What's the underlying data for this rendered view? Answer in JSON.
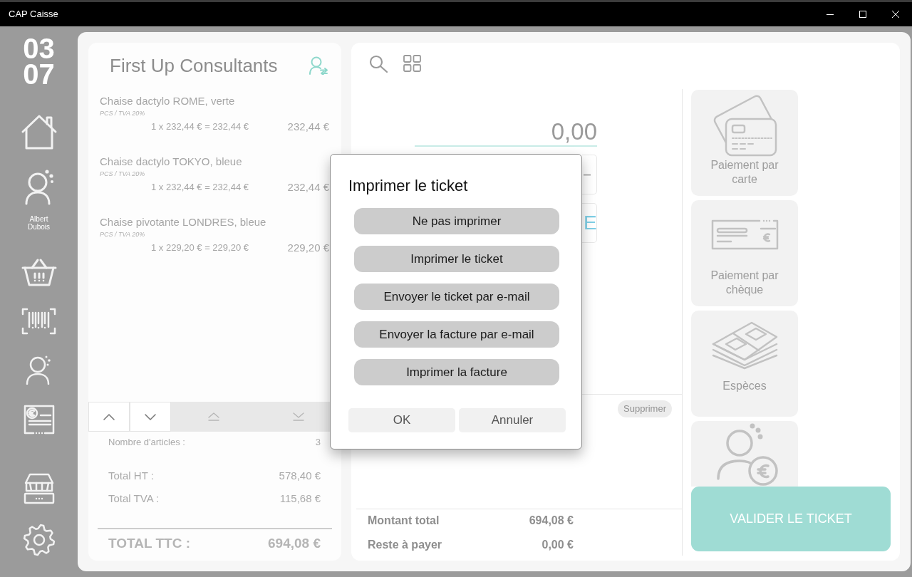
{
  "window": {
    "title": "CAP Caisse"
  },
  "sidebar": {
    "date": [
      "03",
      "07"
    ],
    "user_name": "Albert Dubois"
  },
  "customer": {
    "name": "First Up Consultants"
  },
  "ticket_lines": [
    {
      "product": "Chaise dactylo ROME, verte",
      "unit_tax": "PCS / TVA 20%",
      "calculation": "1 x 232,44 € = 232,44 €",
      "amount": "232,44 €"
    },
    {
      "product": "Chaise dactylo TOKYO, bleue",
      "unit_tax": "PCS / TVA 20%",
      "calculation": "1 x 232,44 € = 232,44 €",
      "amount": "232,44 €"
    },
    {
      "product": "Chaise pivotante LONDRES, bleue",
      "unit_tax": "PCS / TVA 20%",
      "calculation": "1 x 229,20 € = 229,20 €",
      "amount": "229,20 €"
    }
  ],
  "ticket_summary": {
    "item_count": {
      "label": "Nombre d'articles :",
      "value": "3"
    },
    "totals": [
      {
        "label": "Total HT :",
        "value": "578,40 €"
      },
      {
        "label": "Total TVA :",
        "value": "115,68 €"
      }
    ],
    "grand_total": {
      "label": "TOTAL TTC :",
      "value": "694,08 €"
    }
  },
  "payment": {
    "amount_field": {
      "value": "0,00"
    },
    "key_label": "E",
    "delete_button": "Supprimer",
    "totals": [
      {
        "label": "Montant total",
        "value": "694,08 €"
      },
      {
        "label": "Reste à payer",
        "value": "0,00 €"
      }
    ]
  },
  "payment_methods": [
    {
      "kind": "card",
      "label": "Paiement par carte"
    },
    {
      "kind": "cheque",
      "label": "Paiement par chèque"
    },
    {
      "kind": "cash",
      "label": "Espèces"
    },
    {
      "kind": "account"
    }
  ],
  "validate_button": "VALIDER LE TICKET",
  "print_dialog": {
    "title": "Imprimer le ticket",
    "options": [
      "Ne pas imprimer",
      "Imprimer le ticket",
      "Envoyer le ticket par e-mail",
      "Envoyer la facture par e-mail",
      "Imprimer la facture"
    ],
    "buttons": [
      "OK",
      "Annuler"
    ]
  }
}
